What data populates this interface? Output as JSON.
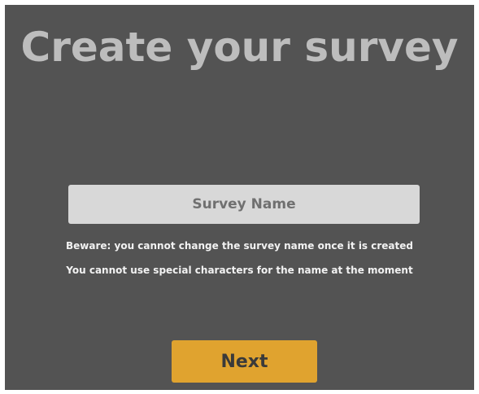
{
  "page": {
    "title": "Create your survey"
  },
  "form": {
    "survey_name_placeholder": "Survey Name",
    "survey_name_value": "",
    "note_1": "Beware: you cannot change the survey name once it is created",
    "note_2": "You cannot use special characters for the name at the moment",
    "next_label": "Next"
  },
  "colors": {
    "panel_background": "#535353",
    "title_text": "#bdbdbd",
    "input_background": "#d8d8d8",
    "button_accent": "#e0a32f"
  }
}
